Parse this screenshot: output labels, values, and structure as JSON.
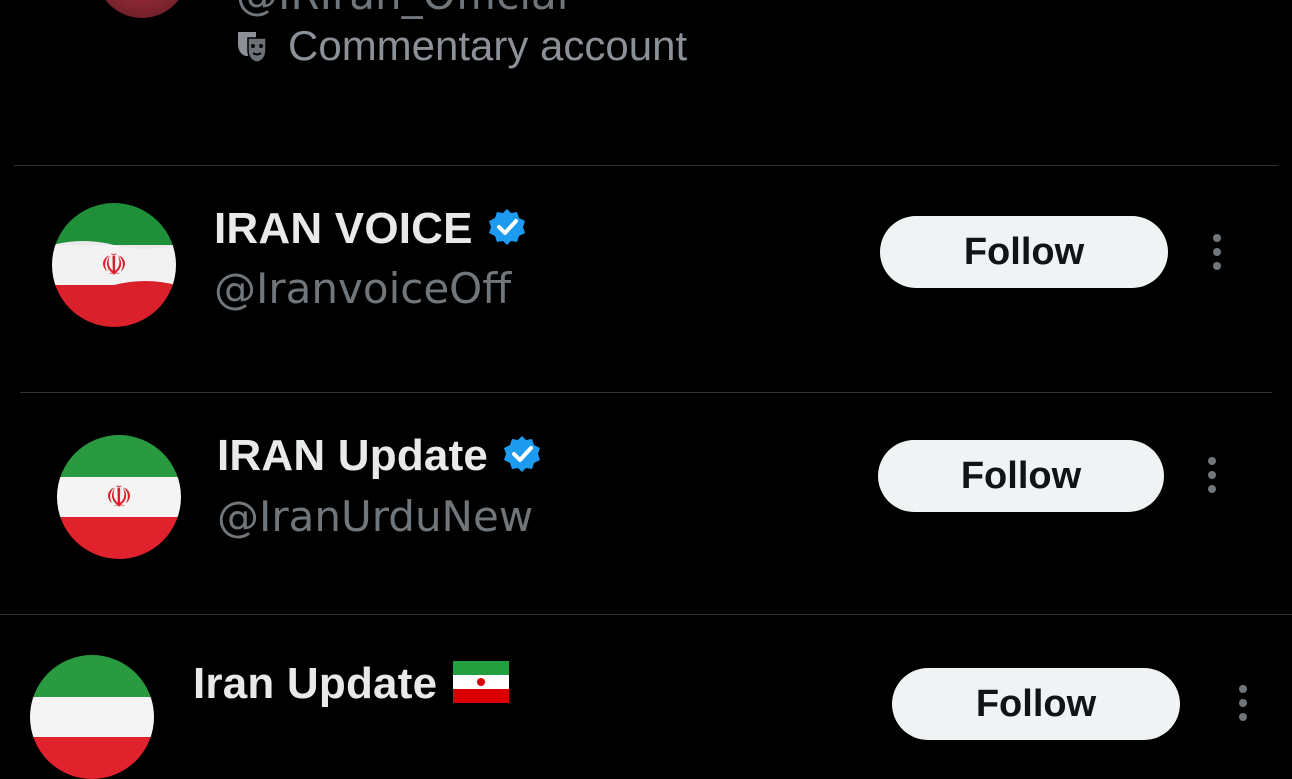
{
  "top_account": {
    "handle_partial": "@IRIran_Official",
    "label_icon": "theater-masks-icon",
    "label": "Commentary account"
  },
  "accounts": [
    {
      "display_name": "IRAN VOICE",
      "handle": "@IranvoiceOff",
      "verified": true,
      "avatar_icon": "iran-flag-icon",
      "follow_label": "Follow"
    },
    {
      "display_name": "IRAN Update",
      "handle": "@IranUrduNew",
      "verified": true,
      "avatar_icon": "iran-flag-icon",
      "follow_label": "Follow"
    },
    {
      "display_name": "Iran Update",
      "name_emoji_icon": "iran-flag-emoji-icon",
      "verified": false,
      "avatar_icon": "iran-flag-icon",
      "follow_label": "Follow"
    }
  ],
  "colors": {
    "background": "#000000",
    "primary_text": "#e7e9ea",
    "secondary_text": "#71767b",
    "verified_blue": "#1d9bf0",
    "follow_bg": "#eff3f4",
    "divider": "#2f3336"
  }
}
